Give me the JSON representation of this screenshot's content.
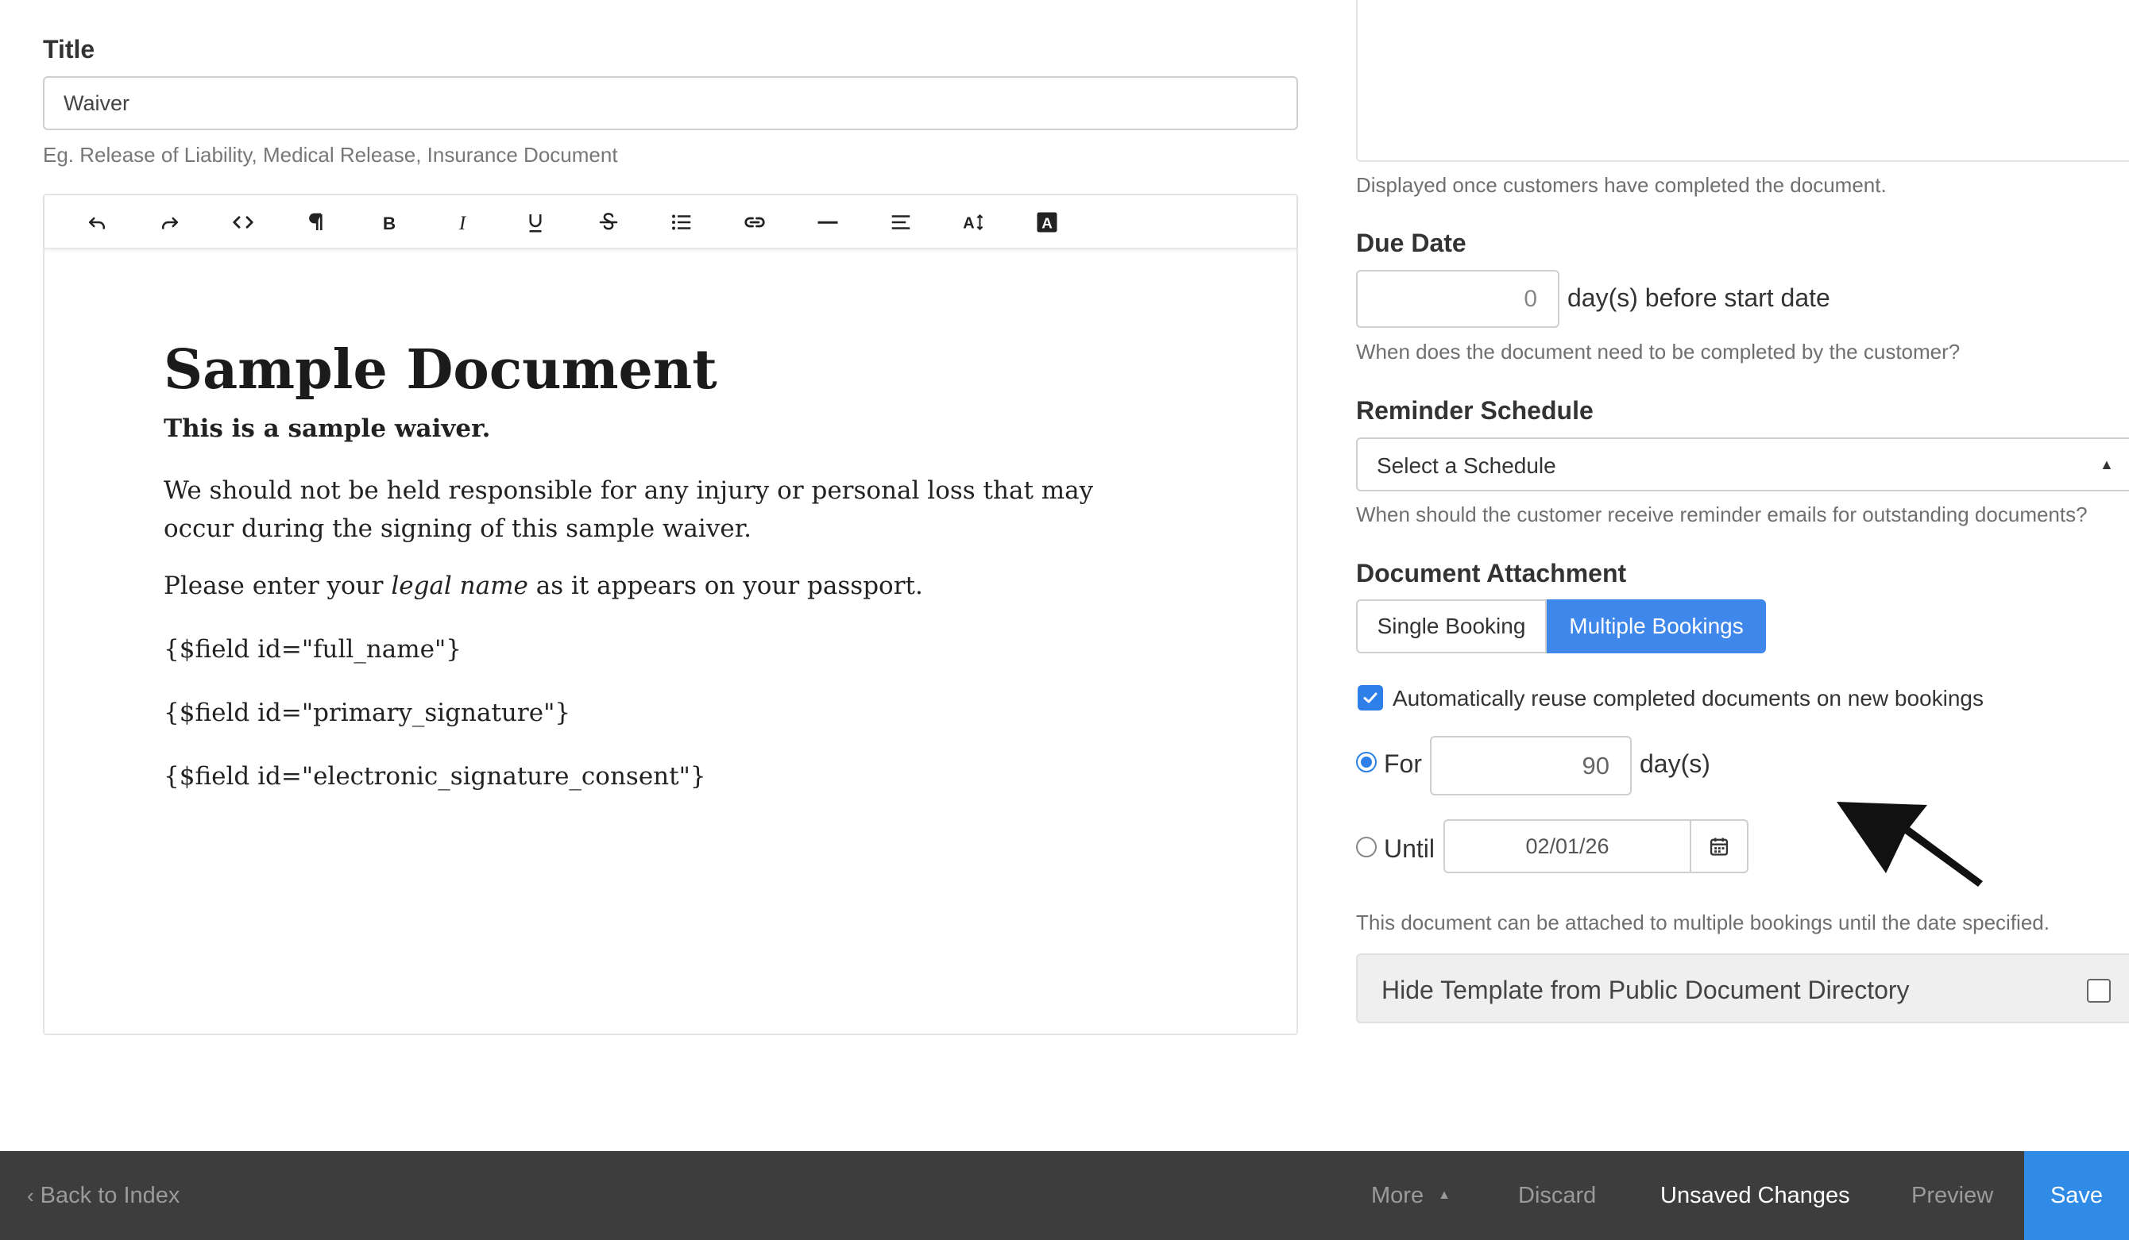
{
  "form": {
    "title_label": "Title",
    "title_value": "Waiver",
    "title_help": "Eg. Release of Liability, Medical Release, Insurance Document"
  },
  "toolbar": {
    "buttons": [
      "undo-icon",
      "redo-icon",
      "code-view-icon",
      "paragraph-icon",
      "bold-icon",
      "italic-icon",
      "underline-icon",
      "strikethrough-icon",
      "list-icon",
      "link-icon",
      "horizontal-rule-icon",
      "align-icon",
      "font-size-icon",
      "font-color-icon"
    ]
  },
  "document": {
    "heading": "Sample Document",
    "intro": "This is a sample waiver.",
    "paragraph": "We should not be held responsible for any injury or personal loss that may occur during the signing of this sample waiver.",
    "name_prefix": "Please enter your ",
    "name_emphasis": "legal name",
    "name_suffix": " as it appears on your passport.",
    "field_1": "{$field id=\"full_name\"}",
    "field_2": "{$field id=\"primary_signature\"}",
    "field_3": "{$field id=\"electronic_signature_consent\"}"
  },
  "sidebar": {
    "completion_help": "Displayed once customers have completed the document.",
    "due_date_label": "Due Date",
    "due_date_value": "0",
    "due_date_suffix": "day(s) before start date",
    "due_date_help": "When does the document need to be completed by the customer?",
    "reminder_label": "Reminder Schedule",
    "reminder_value": "Select a Schedule",
    "reminder_help": "When should the customer receive reminder emails for outstanding documents?",
    "attachment_label": "Document Attachment",
    "attachment_single": "Single Booking",
    "attachment_multiple": "Multiple Bookings",
    "reuse_label": "Automatically reuse completed documents on new bookings",
    "for_label": "For",
    "for_value": "90",
    "for_suffix": "day(s)",
    "until_label": "Until",
    "until_value": "02/01/26",
    "attachment_help": "This document can be attached to multiple bookings until the date specified.",
    "hide_label": "Hide Template from Public Document Directory"
  },
  "footer": {
    "back": "Back to Index",
    "more": "More",
    "discard": "Discard",
    "unsaved": "Unsaved Changes",
    "preview": "Preview",
    "save": "Save"
  },
  "colors": {
    "accent": "#3f87ea",
    "footer_bg": "#3d3d3d",
    "save_bg": "#2f8be6"
  }
}
